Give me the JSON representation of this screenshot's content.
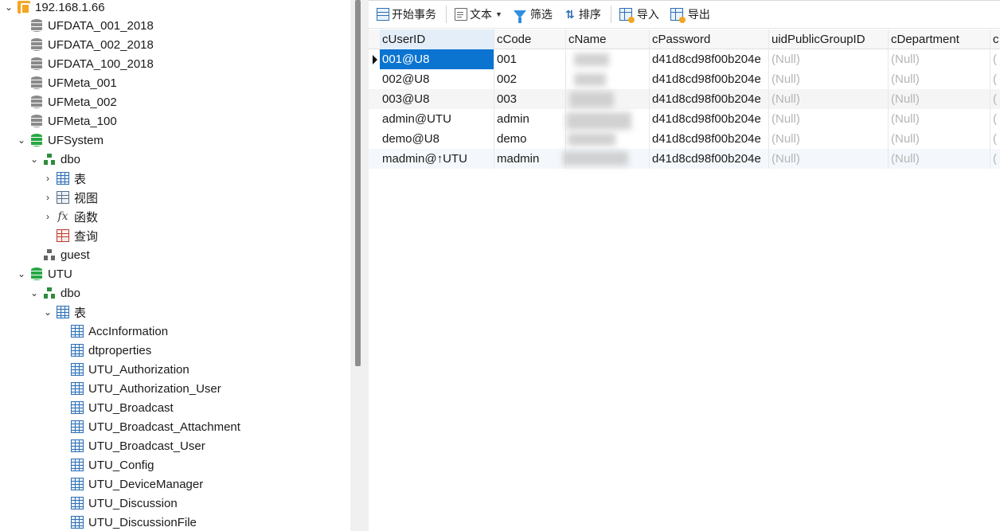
{
  "tree": {
    "server": "192.168.1.66",
    "items": [
      {
        "label": "UFDATA_001_2018"
      },
      {
        "label": "UFDATA_002_2018"
      },
      {
        "label": "UFDATA_100_2018"
      },
      {
        "label": "UFMeta_001"
      },
      {
        "label": "UFMeta_002"
      },
      {
        "label": "UFMeta_100"
      },
      {
        "label": "UFSystem"
      },
      {
        "label": "dbo"
      },
      {
        "label": "表"
      },
      {
        "label": "视图"
      },
      {
        "label": "函数"
      },
      {
        "label": "查询"
      },
      {
        "label": "guest"
      },
      {
        "label": "UTU"
      },
      {
        "label": "dbo"
      },
      {
        "label": "表"
      },
      {
        "label": "AccInformation"
      },
      {
        "label": "dtproperties"
      },
      {
        "label": "UTU_Authorization"
      },
      {
        "label": "UTU_Authorization_User"
      },
      {
        "label": "UTU_Broadcast"
      },
      {
        "label": "UTU_Broadcast_Attachment"
      },
      {
        "label": "UTU_Broadcast_User"
      },
      {
        "label": "UTU_Config"
      },
      {
        "label": "UTU_DeviceManager"
      },
      {
        "label": "UTU_Discussion"
      },
      {
        "label": "UTU_DiscussionFile"
      }
    ]
  },
  "toolbar": {
    "begin_transaction": "开始事务",
    "text": "文本",
    "filter": "筛选",
    "sort": "排序",
    "import": "导入",
    "export": "导出"
  },
  "grid": {
    "columns": [
      "cUserID",
      "cCode",
      "cName",
      "cPassword",
      "uidPublicGroupID",
      "cDepartment",
      "c"
    ],
    "rows": [
      [
        "001@U8",
        "001",
        "",
        "d41d8cd98f00b204e",
        "(Null)",
        "(Null)",
        "("
      ],
      [
        "002@U8",
        "002",
        "",
        "d41d8cd98f00b204e",
        "(Null)",
        "(Null)",
        "("
      ],
      [
        "003@U8",
        "003",
        "",
        "d41d8cd98f00b204e",
        "(Null)",
        "(Null)",
        "("
      ],
      [
        "admin@UTU",
        "admin",
        "",
        "d41d8cd98f00b204e",
        "(Null)",
        "(Null)",
        "("
      ],
      [
        "demo@U8",
        "demo",
        "",
        "d41d8cd98f00b204e",
        "(Null)",
        "(Null)",
        "("
      ],
      [
        "madmin@↑UTU",
        "madmin",
        "",
        "d41d8cd98f00b204e",
        "(Null)",
        "(Null)",
        "("
      ]
    ]
  },
  "colors": {
    "selection": "#0b74d1",
    "header_highlight": "#e3eef9",
    "null_text": "#b5b5b5"
  }
}
